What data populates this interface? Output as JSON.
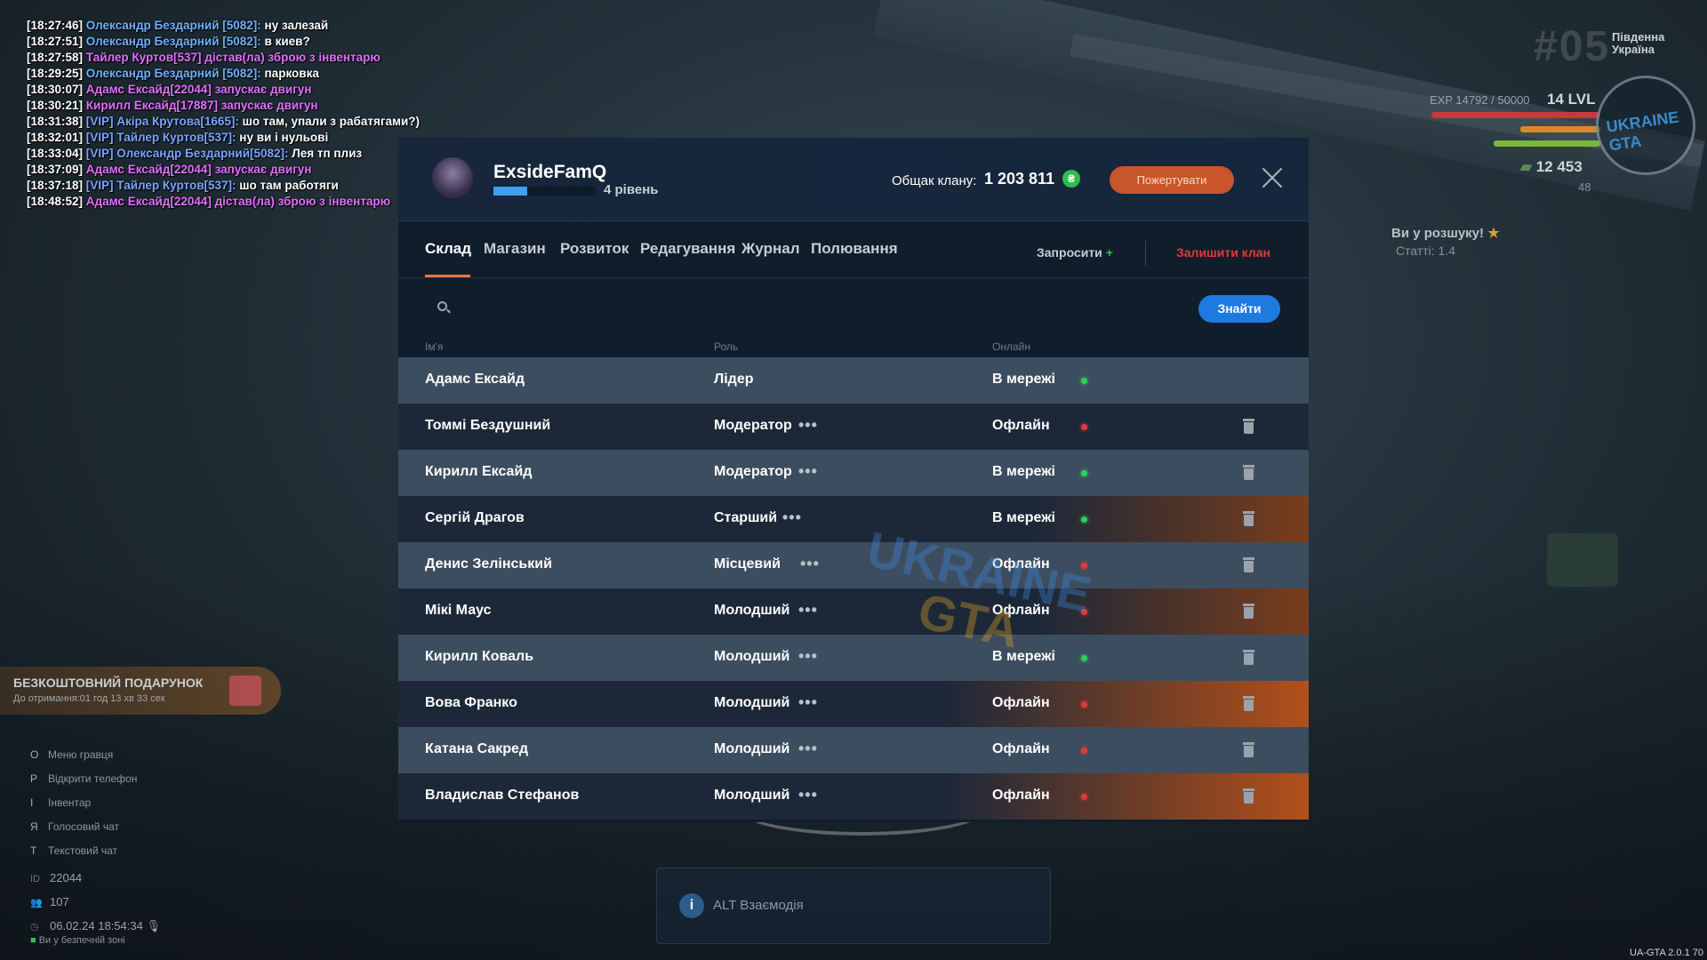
{
  "chat": [
    {
      "time": "[18:27:46]",
      "name": "Олександр Бездарний [5082]:",
      "msg": " ну залезай",
      "kind": "n"
    },
    {
      "time": "[18:27:51]",
      "name": "Олександр Бездарний [5082]:",
      "msg": " в киев?",
      "kind": "n"
    },
    {
      "time": "[18:27:58]",
      "name": " Тайлер Куртов[537] дістав(ла) зброю з інвентарю",
      "msg": "",
      "kind": "p"
    },
    {
      "time": "[18:29:25]",
      "name": "Олександр Бездарний [5082]:",
      "msg": " парковка",
      "kind": "n"
    },
    {
      "time": "[18:30:07]",
      "name": " Адамс Ексайд[22044] запускає двигун",
      "msg": "",
      "kind": "p"
    },
    {
      "time": "[18:30:21]",
      "name": " Кирилл Ексайд[17887] запускає двигун",
      "msg": "",
      "kind": "p"
    },
    {
      "time": "[18:31:38]",
      "name": " [VIP] Акіра Крутова[1665]:",
      "msg": " шо там, упали з рабатягами?)",
      "kind": "v"
    },
    {
      "time": "[18:32:01]",
      "name": " [VIP] Тайлер Куртов[537]:",
      "msg": " ну ви і нульові",
      "kind": "v"
    },
    {
      "time": "[18:33:04]",
      "name": " [VIP] Олександр Бездарний[5082]:",
      "msg": " Лея тп плиз",
      "kind": "v"
    },
    {
      "time": "[18:37:09]",
      "name": " Адамс Ексайд[22044] запускає двигун",
      "msg": "",
      "kind": "p"
    },
    {
      "time": "[18:37:18]",
      "name": " [VIP] Тайлер Куртов[537]:",
      "msg": " шо там работяги",
      "kind": "v"
    },
    {
      "time": "[18:48:52]",
      "name": " Адамс Ексайд[22044] дістав(ла) зброю з інвентарю",
      "msg": "",
      "kind": "p"
    }
  ],
  "hud": {
    "server_num": "#05",
    "region": "Південна Україна",
    "exp": "EXP 14792 / 50000",
    "level": "14 LVL",
    "money": "12 453",
    "coins": "48",
    "logo_text": "UKRAINE GTA",
    "wanted": "Ви у розшуку!",
    "article": "Статті: 1.4"
  },
  "gift": {
    "title": "БЕЗКОШТОВНИЙ ПОДАРУНОК",
    "subtitle": "До отримання:01 год 13 хв 33 сек"
  },
  "hints": [
    {
      "key": "O",
      "label": "Меню гравця"
    },
    {
      "key": "P",
      "label": "Відкрити телефон"
    },
    {
      "key": "I",
      "label": "Інвентар"
    },
    {
      "key": "Я",
      "label": "Голосовий чат"
    },
    {
      "key": "T",
      "label": "Текстовий чат"
    }
  ],
  "info": {
    "id_label": "ID",
    "id": "22044",
    "online": "107",
    "datetime": "06.02.24 18:54:34",
    "safe": "Ви у безпечній зоні"
  },
  "alt": {
    "icon": "i",
    "label": "ALT Взаємодія"
  },
  "version": "UA-GTA 2.0.1 70",
  "clan": {
    "name": "ExsideFamQ",
    "level_text": "4 рівень",
    "level_progress": 0.33,
    "total_label": "Общак клану:",
    "total_value": "1 203 811",
    "coin_symbol": "₴",
    "donate_label": "Пожертувати",
    "tabs": [
      "Склад",
      "Магазин",
      "Розвиток",
      "Редагування",
      "Журнал",
      "Полювання"
    ],
    "invite_label": "Запросити",
    "invite_plus": "+",
    "leave_label": "Залишити клан",
    "search_placeholder": "",
    "find_label": "Знайти",
    "columns": {
      "name": "Ім'я",
      "role": "Роль",
      "online": "Онлайн"
    },
    "watermark_top": "UKRAINE",
    "watermark_bottom": "GTA",
    "members": [
      {
        "name": "Адамс Ексайд",
        "role": "Лідер",
        "status": "В мережі",
        "online": true,
        "menu": false,
        "delete": false
      },
      {
        "name": "Томмі Бездушний",
        "role": "Модератор",
        "status": "Офлайн",
        "online": false,
        "menu": true,
        "delete": true
      },
      {
        "name": "Кирилл Ексайд",
        "role": "Модератор",
        "status": "В мережі",
        "online": true,
        "menu": true,
        "delete": true
      },
      {
        "name": "Сергій Драгов",
        "role": "Старший",
        "status": "В мережі",
        "online": true,
        "menu": true,
        "delete": true
      },
      {
        "name": "Денис Зелінський",
        "role": "Місцевий",
        "status": "Офлайн",
        "online": false,
        "menu": true,
        "delete": true
      },
      {
        "name": "Мікі Маус",
        "role": "Молодший",
        "status": "Офлайн",
        "online": false,
        "menu": true,
        "delete": true
      },
      {
        "name": "Кирилл Коваль",
        "role": "Молодший",
        "status": "В мережі",
        "online": true,
        "menu": true,
        "delete": true
      },
      {
        "name": "Вова Франко",
        "role": "Молодший",
        "status": "Офлайн",
        "online": false,
        "menu": true,
        "delete": true
      },
      {
        "name": "Катана Сакред",
        "role": "Молодший",
        "status": "Офлайн",
        "online": false,
        "menu": true,
        "delete": true
      },
      {
        "name": "Владислав Стефанов",
        "role": "Молодший",
        "status": "Офлайн",
        "online": false,
        "menu": true,
        "delete": true
      }
    ],
    "menu_glyph": "•••"
  }
}
